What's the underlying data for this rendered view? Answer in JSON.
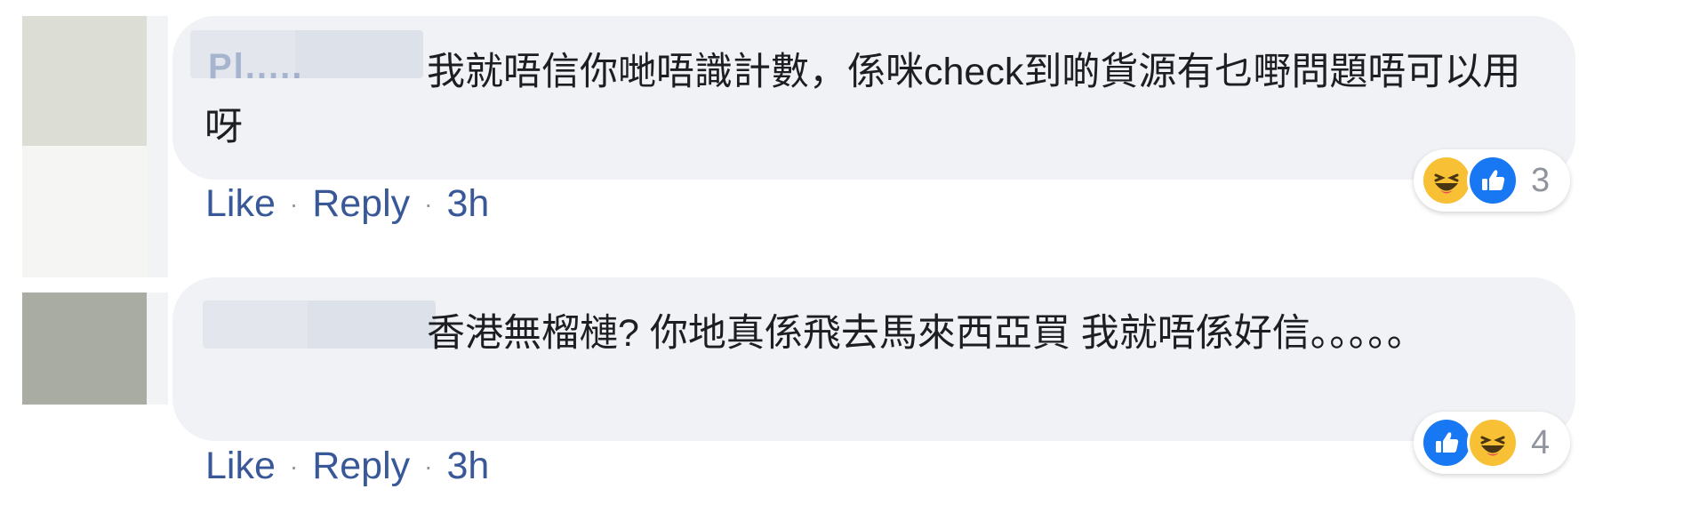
{
  "comments": [
    {
      "author_fragment": "Pl.....",
      "text": "我就唔信你哋唔識計數，係咪check到啲貨源有乜嘢問題唔可以用呀",
      "actions": {
        "like": "Like",
        "reply": "Reply",
        "time": "3h",
        "dot": "·"
      },
      "reactions": {
        "icons": [
          "haha-icon",
          "like-icon"
        ],
        "count": "3"
      },
      "avatar_color": "#dcddd4"
    },
    {
      "author_fragment": "",
      "text": "香港無榴槤? 你地真係飛去馬來西亞買 我就唔係好信。。。。。",
      "actions": {
        "like": "Like",
        "reply": "Reply",
        "time": "3h",
        "dot": "·"
      },
      "reactions": {
        "icons": [
          "like-icon",
          "haha-icon"
        ],
        "count": "4"
      },
      "avatar_color": "#a9aca3"
    }
  ],
  "colors": {
    "link": "#385898",
    "bubble": "#f0f2f5",
    "like_blue": "#1877f2",
    "haha_yellow": "#f7c035",
    "meta_gray": "#90949c"
  }
}
